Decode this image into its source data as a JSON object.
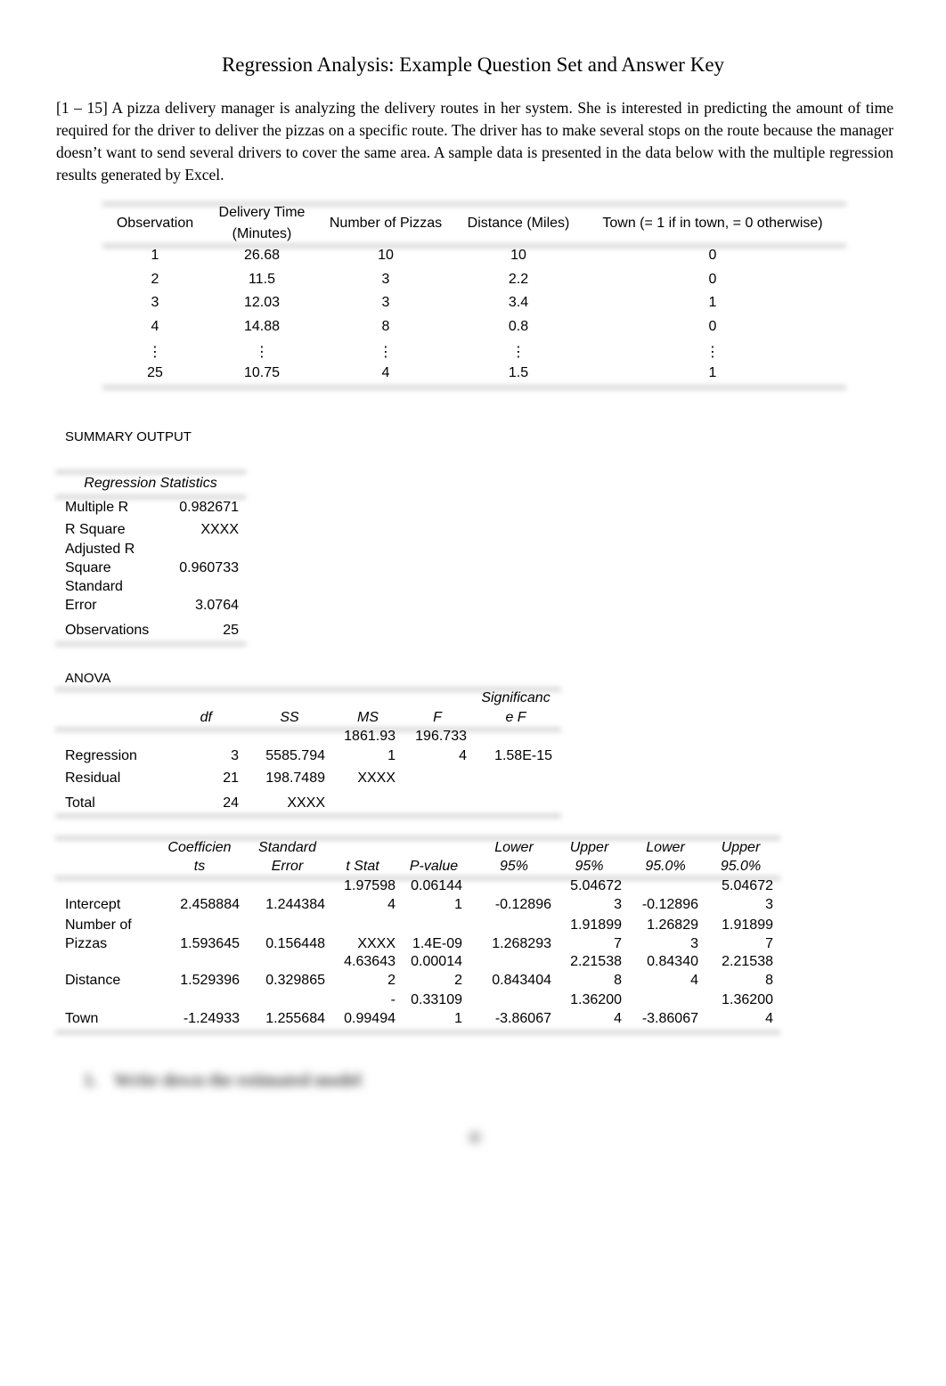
{
  "title": "Regression Analysis: Example Question Set and Answer Key",
  "intro": "[1 – 15] A pizza delivery manager is analyzing the delivery routes in her system. She is interested in predicting the amount of time required for the driver to deliver the pizzas on a specific route. The driver has to make several stops on the route because the manager doesn’t want to send several drivers to cover the same area. A sample data is presented in the data below with the multiple regression results generated by Excel.",
  "data_table": {
    "headers": [
      "Observation",
      "Delivery Time",
      "(Minutes)",
      "Number of Pizzas",
      "Distance (Miles)",
      "Town (= 1 if in town, = 0 otherwise)"
    ],
    "rows": [
      [
        "1",
        "26.68",
        "10",
        "10",
        "0"
      ],
      [
        "2",
        "11.5",
        "3",
        "2.2",
        "0"
      ],
      [
        "3",
        "12.03",
        "3",
        "3.4",
        "1"
      ],
      [
        "4",
        "14.88",
        "8",
        "0.8",
        "0"
      ],
      [
        "⋮",
        "⋮",
        "⋮",
        "⋮",
        "⋮"
      ],
      [
        "25",
        "10.75",
        "4",
        "1.5",
        "1"
      ]
    ]
  },
  "summary": {
    "heading": "SUMMARY OUTPUT",
    "reg_stats_title": "Regression Statistics",
    "stats": [
      {
        "label": [
          "Multiple R"
        ],
        "value": "0.982671"
      },
      {
        "label": [
          "R Square"
        ],
        "value": "XXXX"
      },
      {
        "label": [
          "Adjusted R",
          "Square"
        ],
        "value": "0.960733"
      },
      {
        "label": [
          "Standard",
          "Error"
        ],
        "value": "3.0764"
      },
      {
        "label": [
          "Observations"
        ],
        "value": "25"
      }
    ]
  },
  "anova": {
    "heading": "ANOVA",
    "headers": {
      "df": "df",
      "ss": "SS",
      "ms": "MS",
      "f": "F",
      "sig1": "Significanc",
      "sig2": "e F"
    },
    "rows": [
      {
        "label": "Regression",
        "df": "3",
        "ss": "5585.794",
        "ms": [
          "1861.93",
          "1"
        ],
        "f": [
          "196.733",
          "4"
        ],
        "sig": "1.58E-15"
      },
      {
        "label": "Residual",
        "df": "21",
        "ss": "198.7489",
        "ms": [
          "XXXX"
        ],
        "f": [],
        "sig": ""
      },
      {
        "label": "Total",
        "df": "24",
        "ss": "XXXX",
        "ms": [],
        "f": [],
        "sig": ""
      }
    ]
  },
  "coefficients": {
    "headers": {
      "coef": [
        "Coefficien",
        "ts"
      ],
      "se": [
        "Standard",
        "Error"
      ],
      "t": [
        "t Stat"
      ],
      "p": [
        "P-value"
      ],
      "l95": [
        "Lower",
        "95%"
      ],
      "u95": [
        "Upper",
        "95%"
      ],
      "l950": [
        "Lower",
        "95.0%"
      ],
      "u950": [
        "Upper",
        "95.0%"
      ]
    },
    "rows": [
      {
        "label": [
          "Intercept"
        ],
        "coef": "2.458884",
        "se": "1.244384",
        "t": [
          "1.97598",
          "4"
        ],
        "p": [
          "0.06144",
          "1"
        ],
        "l95": "-0.12896",
        "u95": [
          "5.04672",
          "3"
        ],
        "l950": [
          "-0.12896"
        ],
        "u950": [
          "5.04672",
          "3"
        ]
      },
      {
        "label": [
          "Number of",
          "Pizzas"
        ],
        "coef": "1.593645",
        "se": "0.156448",
        "t": [
          "XXXX"
        ],
        "p": [
          "1.4E-09"
        ],
        "l95": "1.268293",
        "u95": [
          "1.91899",
          "7"
        ],
        "l950": [
          "1.26829",
          "3"
        ],
        "u950": [
          "1.91899",
          "7"
        ]
      },
      {
        "label": [
          "Distance"
        ],
        "coef": "1.529396",
        "se": "0.329865",
        "t": [
          "4.63643",
          "2"
        ],
        "p": [
          "0.00014",
          "2"
        ],
        "l95": "0.843404",
        "u95": [
          "2.21538",
          "8"
        ],
        "l950": [
          "0.84340",
          "4"
        ],
        "u950": [
          "2.21538",
          "8"
        ]
      },
      {
        "label": [
          "Town"
        ],
        "coef": "-1.24933",
        "se": "1.255684",
        "t": [
          "-",
          "0.99494"
        ],
        "p": [
          "0.33109",
          "1"
        ],
        "l95": "-3.86067",
        "u95": [
          "1.36200",
          "4"
        ],
        "l950": [
          "-3.86067"
        ],
        "u950": [
          "1.36200",
          "4"
        ]
      }
    ]
  },
  "question": {
    "number": "1.",
    "text": "Write down the estimated model"
  }
}
